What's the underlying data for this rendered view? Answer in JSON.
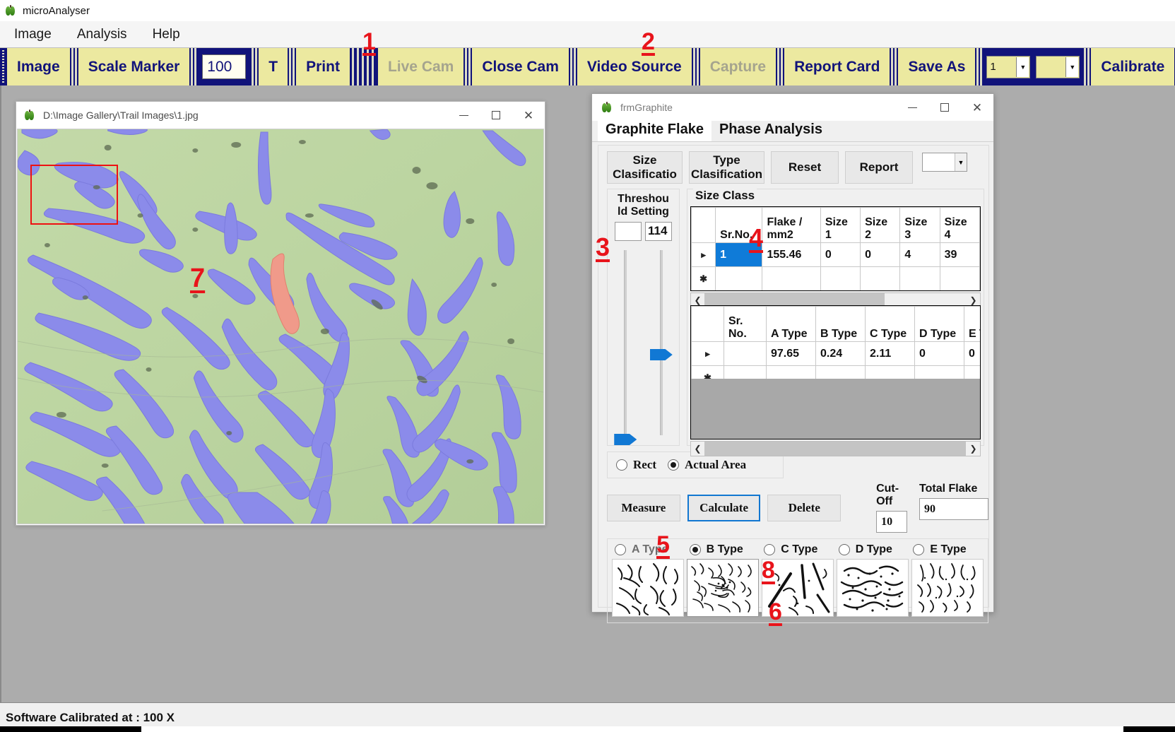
{
  "window": {
    "app_title": "microAnalyser",
    "app_icon": "apple-icon"
  },
  "menubar": {
    "items": [
      {
        "label": "Image"
      },
      {
        "label": "Analysis"
      },
      {
        "label": "Help"
      }
    ]
  },
  "toolbar": {
    "image_label": "Image",
    "scale_marker_label": "Scale Marker",
    "scale_value": "100",
    "t_label": "T",
    "print_label": "Print",
    "live_cam_label": "Live Cam",
    "close_cam_label": "Close Cam",
    "video_source_label": "Video Source",
    "capture_label": "Capture",
    "report_card_label": "Report Card",
    "save_as_label": "Save As",
    "combo1_value": "1",
    "combo2_value": "",
    "calibrate_label": "Calibrate"
  },
  "image_window": {
    "title": "D:\\Image Gallery\\Trail Images\\1.jpg",
    "minimize": "—",
    "maximize": "□",
    "close": "✕",
    "annotation_7": "7"
  },
  "frm": {
    "title": "frmGraphite",
    "minimize": "—",
    "maximize": "□",
    "close": "✕",
    "tabs": [
      {
        "label": "Graphite Flake",
        "active": true
      },
      {
        "label": "Phase Analysis",
        "active": false
      }
    ],
    "buttons": {
      "size_classification": "Size\nClasificatio",
      "size_classification_l1": "Size",
      "size_classification_l2": "Clasificatio",
      "type_classification_l1": "Type",
      "type_classification_l2": "Clasification",
      "reset": "Reset",
      "report": "Report"
    },
    "top_combo_value": "",
    "threshold": {
      "label_l1": "Threshou",
      "label_l2": "ld Setting",
      "value_left": "",
      "value_right": "114"
    },
    "size_class": {
      "group_label": "Size Class",
      "columns": [
        "",
        "Sr.No.",
        "Flake /\nmm2",
        "Size\n1",
        "Size\n2",
        "Size\n3",
        "Size\n4"
      ],
      "columns_flat": [
        "",
        "Sr.No.",
        "Flake / mm2",
        "Size 1",
        "Size 2",
        "Size 3",
        "Size 4"
      ],
      "col_c2_l1": "Flake /",
      "col_c2_l2": "mm2",
      "rows": [
        {
          "marker": "▸",
          "sr_no": "1",
          "flake_mm2": "155.46",
          "size1": "0",
          "size2": "0",
          "size3": "4",
          "size4": "39"
        }
      ],
      "new_row_marker": "✱"
    },
    "type_class": {
      "columns": [
        "",
        "Sr.\nNo.",
        "A Type",
        "B Type",
        "C Type",
        "D Type",
        "E Ty"
      ],
      "col_sr_l1": "Sr.",
      "col_sr_l2": "No.",
      "col_a": "A Type",
      "col_b": "B Type",
      "col_c": "C Type",
      "col_d": "D Type",
      "col_e": "E Ty",
      "rows": [
        {
          "marker": "▸",
          "sr_no": "",
          "a_type": "97.65",
          "b_type": "0.24",
          "c_type": "2.11",
          "d_type": "0",
          "e_type": "0"
        }
      ],
      "new_row_marker": "✱"
    },
    "area_mode": {
      "options": [
        {
          "label": "Rect",
          "selected": false
        },
        {
          "label": "Actual Area",
          "selected": true
        }
      ]
    },
    "actions": {
      "measure": "Measure",
      "calculate": "Calculate",
      "delete": "Delete"
    },
    "cutoff": {
      "cut_off_label": "Cut-Off",
      "cut_off_value": "10",
      "total_flake_label": "Total Flake",
      "total_flake_value": "90"
    },
    "flake_types": {
      "options": [
        {
          "label": "A Type",
          "selected": false
        },
        {
          "label": "B Type",
          "selected": true
        },
        {
          "label": "C Type",
          "selected": false
        },
        {
          "label": "D Type",
          "selected": false
        },
        {
          "label": "E Type",
          "selected": false
        }
      ]
    }
  },
  "annotations": {
    "a1": "1",
    "a2": "2",
    "a3": "3",
    "a4": "4",
    "a5": "5",
    "a6": "6",
    "a7": "7",
    "a8": "8"
  },
  "statusbar": {
    "text": "Software Calibrated at :  100  X"
  },
  "colors": {
    "toolbar_bg": "#11137a",
    "toolbar_button": "#ece9a0",
    "annotation": "#e8141b",
    "selection": "#0f7bd8",
    "workspace": "#acacac",
    "flake_overlay": "#8b8bea",
    "flake_highlight": "#f09a8a",
    "matrix": "#bcd4a2"
  }
}
